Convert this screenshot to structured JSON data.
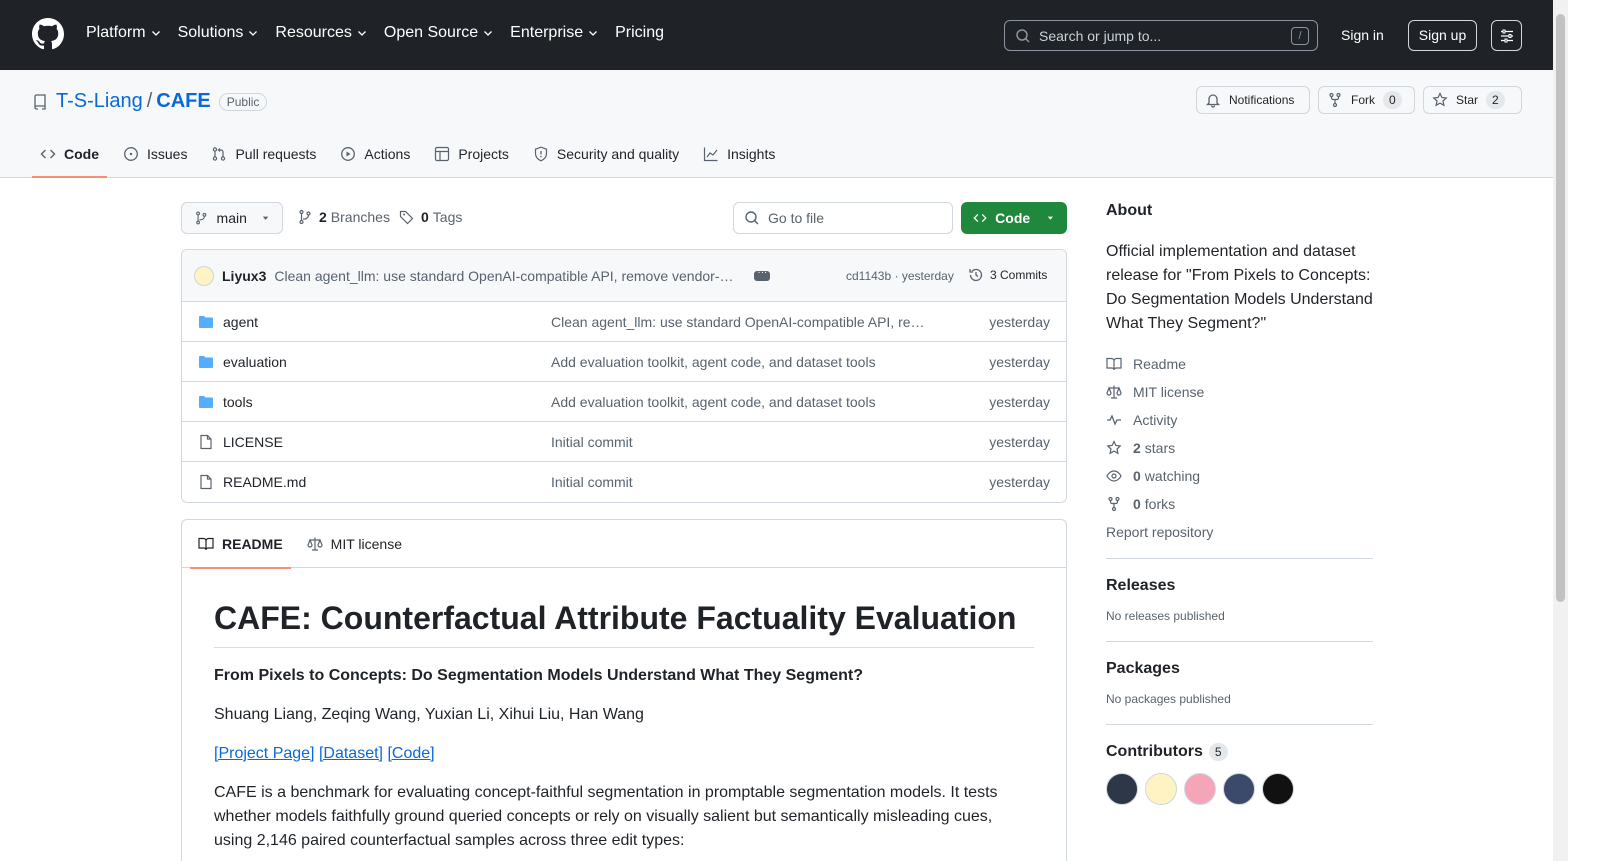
{
  "nav": {
    "items": [
      "Platform",
      "Solutions",
      "Resources",
      "Open Source",
      "Enterprise"
    ],
    "pricing": "Pricing",
    "search_placeholder": "Search or jump to...",
    "search_shortcut": "/",
    "sign_in": "Sign in",
    "sign_up": "Sign up"
  },
  "repo": {
    "owner": "T-S-Liang",
    "separator": "/",
    "name": "CAFE",
    "visibility": "Public",
    "notifications": "Notifications",
    "fork_label": "Fork",
    "fork_count": "0",
    "star_label": "Star",
    "star_count": "2"
  },
  "tabs": [
    "Code",
    "Issues",
    "Pull requests",
    "Actions",
    "Projects",
    "Security and quality",
    "Insights"
  ],
  "branch": {
    "current": "main",
    "branches_count": "2",
    "branches_label": "Branches",
    "tags_count": "0",
    "tags_label": "Tags",
    "go_to_file": "Go to file",
    "code_button": "Code"
  },
  "commit": {
    "author": "Liyux3",
    "message": "Clean agent_llm: use standard OpenAI-compatible API, remove vendor-specific code",
    "hash_time": "cd1143b · yesterday",
    "commits": "3 Commits"
  },
  "files": [
    {
      "name": "agent",
      "type": "dir",
      "message": "Clean agent_llm: use standard OpenAI-compatible API, remove vendor-specific code",
      "time": "yesterday"
    },
    {
      "name": "evaluation",
      "type": "dir",
      "message": "Add evaluation toolkit, agent code, and dataset tools",
      "time": "yesterday"
    },
    {
      "name": "tools",
      "type": "dir",
      "message": "Add evaluation toolkit, agent code, and dataset tools",
      "time": "yesterday"
    },
    {
      "name": "LICENSE",
      "type": "file",
      "message": "Initial commit",
      "time": "yesterday"
    },
    {
      "name": "README.md",
      "type": "file",
      "message": "Initial commit",
      "time": "yesterday"
    }
  ],
  "readme": {
    "tab_readme": "README",
    "tab_license": "MIT license",
    "title": "CAFE: Counterfactual Attribute Factuality Evaluation",
    "subtitle": "From Pixels to Concepts: Do Segmentation Models Understand What They Segment?",
    "authors": "Shuang Liang, Zeqing Wang, Yuxian Li, Xihui Liu, Han Wang",
    "links": [
      "[Project Page]",
      "[Dataset]",
      "[Code]"
    ],
    "intro": "CAFE is a benchmark for evaluating concept-faithful segmentation in promptable segmentation models. It tests whether models faithfully ground queried concepts or rely on visually salient but semantically misleading cues, using 2,146 paired counterfactual samples across three edit types:"
  },
  "about": {
    "heading": "About",
    "description": "Official implementation and dataset release for \"From Pixels to Concepts: Do Segmentation Models Understand What They Segment?\"",
    "readme": "Readme",
    "license": "MIT license",
    "activity": "Activity",
    "stars_count": "2",
    "stars_label": "stars",
    "watching_count": "0",
    "watching_label": "watching",
    "forks_count": "0",
    "forks_label": "forks",
    "report": "Report repository"
  },
  "releases": {
    "heading": "Releases",
    "text": "No releases published"
  },
  "packages": {
    "heading": "Packages",
    "text": "No packages published"
  },
  "contributors": {
    "heading": "Contributors",
    "count": "5"
  },
  "colors": {
    "header_bg": "#1f2328",
    "link": "#0969da",
    "code_button": "#1f883d",
    "tab_underline": "#fd8c73"
  }
}
